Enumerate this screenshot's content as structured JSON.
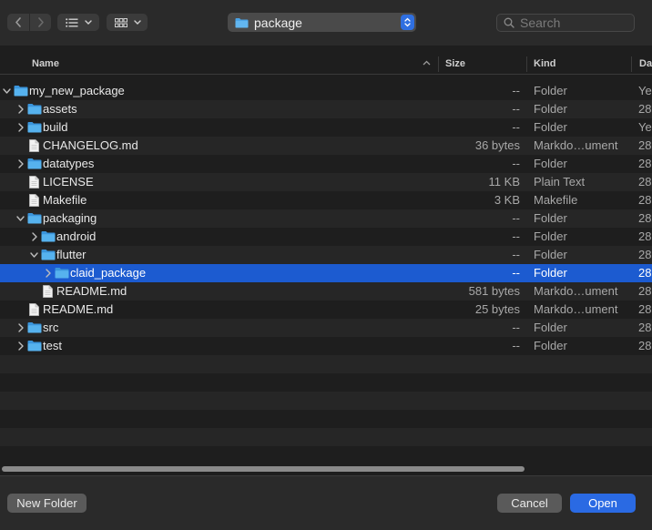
{
  "toolbar": {
    "path_label": "package",
    "search_placeholder": "Search"
  },
  "columns": {
    "name": "Name",
    "size": "Size",
    "kind": "Kind",
    "date": "Dat"
  },
  "rows": [
    {
      "name": "my_new_package",
      "size": "--",
      "kind": "Folder",
      "date": "Ye",
      "depth": 0,
      "type": "folder",
      "expanded": true
    },
    {
      "name": "assets",
      "size": "--",
      "kind": "Folder",
      "date": "28",
      "depth": 1,
      "type": "folder",
      "expanded": false
    },
    {
      "name": "build",
      "size": "--",
      "kind": "Folder",
      "date": "Ye",
      "depth": 1,
      "type": "folder",
      "expanded": false
    },
    {
      "name": "CHANGELOG.md",
      "size": "36 bytes",
      "kind": "Markdo…ument",
      "date": "28",
      "depth": 1,
      "type": "file"
    },
    {
      "name": "datatypes",
      "size": "--",
      "kind": "Folder",
      "date": "28",
      "depth": 1,
      "type": "folder",
      "expanded": false
    },
    {
      "name": "LICENSE",
      "size": "11 KB",
      "kind": "Plain Text",
      "date": "28",
      "depth": 1,
      "type": "file"
    },
    {
      "name": "Makefile",
      "size": "3 KB",
      "kind": "Makefile",
      "date": "28",
      "depth": 1,
      "type": "file"
    },
    {
      "name": "packaging",
      "size": "--",
      "kind": "Folder",
      "date": "28",
      "depth": 1,
      "type": "folder",
      "expanded": true
    },
    {
      "name": "android",
      "size": "--",
      "kind": "Folder",
      "date": "28",
      "depth": 2,
      "type": "folder",
      "expanded": false
    },
    {
      "name": "flutter",
      "size": "--",
      "kind": "Folder",
      "date": "28",
      "depth": 2,
      "type": "folder",
      "expanded": true
    },
    {
      "name": "claid_package",
      "size": "--",
      "kind": "Folder",
      "date": "28",
      "depth": 3,
      "type": "folder",
      "expanded": false,
      "selected": true
    },
    {
      "name": "README.md",
      "size": "581 bytes",
      "kind": "Markdo…ument",
      "date": "28",
      "depth": 2,
      "type": "file"
    },
    {
      "name": "README.md",
      "size": "25 bytes",
      "kind": "Markdo…ument",
      "date": "28",
      "depth": 1,
      "type": "file"
    },
    {
      "name": "src",
      "size": "--",
      "kind": "Folder",
      "date": "28",
      "depth": 1,
      "type": "folder",
      "expanded": false
    },
    {
      "name": "test",
      "size": "--",
      "kind": "Folder",
      "date": "28",
      "depth": 1,
      "type": "folder",
      "expanded": false
    }
  ],
  "empty_row_count": 6,
  "buttons": {
    "new_folder": "New Folder",
    "cancel": "Cancel",
    "open": "Open"
  },
  "colors": {
    "accent": "#2a6ae3",
    "selection": "#1c5bd0",
    "folder": "#4aa3e6"
  },
  "icons": {
    "back": "chevron-left-icon",
    "forward": "chevron-right-icon",
    "list_view": "list-view-icon",
    "grid_view": "grid-view-icon",
    "folder": "folder-icon",
    "file": "document-icon",
    "search": "search-icon"
  }
}
